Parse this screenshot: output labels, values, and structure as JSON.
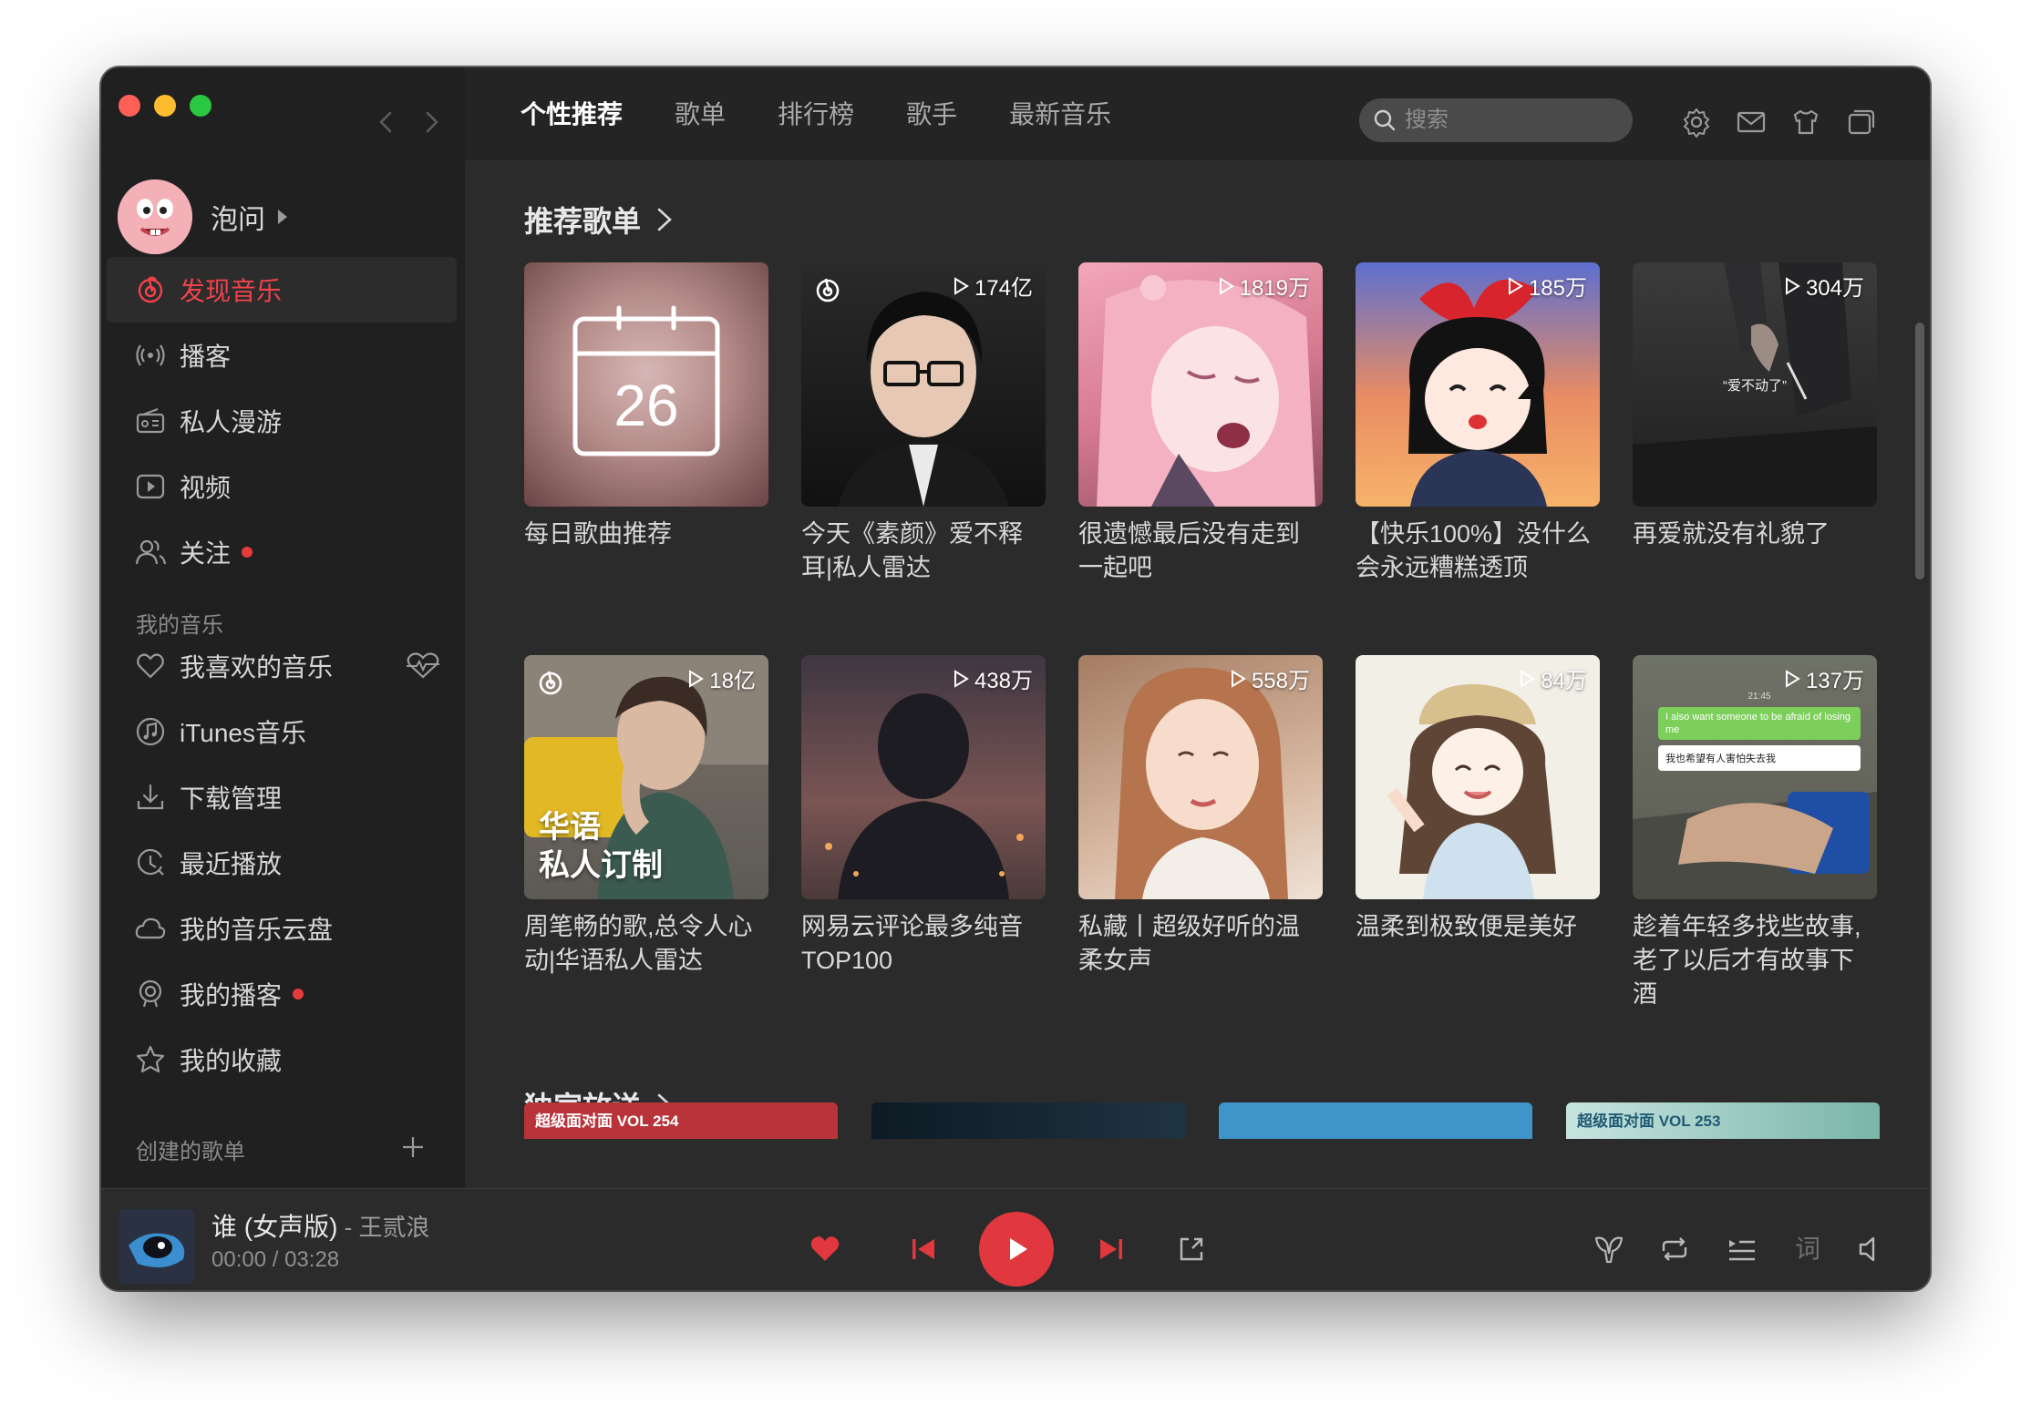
{
  "window": {
    "traffic_lights": [
      "close",
      "minimize",
      "zoom"
    ]
  },
  "header": {
    "tabs": [
      {
        "label": "个性推荐",
        "active": true
      },
      {
        "label": "歌单",
        "active": false
      },
      {
        "label": "排行榜",
        "active": false
      },
      {
        "label": "歌手",
        "active": false
      },
      {
        "label": "最新音乐",
        "active": false
      }
    ],
    "search_placeholder": "搜索",
    "icons": [
      "gear-icon",
      "mail-icon",
      "skin-icon",
      "mini-window-icon"
    ]
  },
  "sidebar": {
    "user": {
      "name": "泡问"
    },
    "nav": [
      {
        "label": "发现音乐",
        "icon": "netease-music-icon",
        "active": true,
        "dot": false
      },
      {
        "label": "播客",
        "icon": "podcast-icon",
        "active": false,
        "dot": false
      },
      {
        "label": "私人漫游",
        "icon": "radio-icon",
        "active": false,
        "dot": false
      },
      {
        "label": "视频",
        "icon": "video-icon",
        "active": false,
        "dot": false
      },
      {
        "label": "关注",
        "icon": "friends-icon",
        "active": false,
        "dot": true
      }
    ],
    "my_music_title": "我的音乐",
    "my_music": [
      {
        "label": "我喜欢的音乐",
        "icon": "heart-icon",
        "dot": false
      },
      {
        "label": "iTunes音乐",
        "icon": "itunes-icon",
        "dot": false
      },
      {
        "label": "下载管理",
        "icon": "download-icon",
        "dot": false
      },
      {
        "label": "最近播放",
        "icon": "recent-icon",
        "dot": false
      },
      {
        "label": "我的音乐云盘",
        "icon": "cloud-icon",
        "dot": false
      },
      {
        "label": "我的播客",
        "icon": "my-podcast-icon",
        "dot": true
      },
      {
        "label": "我的收藏",
        "icon": "star-icon",
        "dot": false
      }
    ],
    "created_playlists_title": "创建的歌单"
  },
  "main": {
    "recommended_title": "推荐歌单",
    "playlists": [
      {
        "name": "每日歌曲推荐",
        "plays": "",
        "radar": false,
        "daily_date": "26"
      },
      {
        "name": "今天《素颜》爱不释耳|私人雷达",
        "plays": "174亿",
        "radar": true
      },
      {
        "name": "很遗憾最后没有走到一起吧",
        "plays": "1819万",
        "radar": false
      },
      {
        "name": "【快乐100%】没什么会永远糟糕透顶",
        "plays": "185万",
        "radar": false
      },
      {
        "name": "再爱就没有礼貌了",
        "plays": "304万",
        "radar": false,
        "cover_caption": "“爱不动了”"
      },
      {
        "name": "周笔畅的歌,总令人心动|华语私人雷达",
        "plays": "18亿",
        "radar": true,
        "cover_caption": "华语\n私人订制"
      },
      {
        "name": "网易云评论最多纯音TOP100",
        "plays": "438万",
        "radar": false
      },
      {
        "name": "私藏丨超级好听的温柔女声",
        "plays": "558万",
        "radar": false
      },
      {
        "name": "温柔到极致便是美好",
        "plays": "84万",
        "radar": false
      },
      {
        "name": "趁着年轻多找些故事,老了以后才有故事下酒",
        "plays": "137万",
        "radar": false,
        "cover_chat": [
          "21:45",
          "I also want someone to be afraid of losing me",
          "我也希望有人害怕失去我"
        ]
      }
    ],
    "exclusive_title": "独家放送",
    "exclusive_cards": [
      "超级面对面 VOL 254",
      "",
      "",
      "超级面对面 VOL 253"
    ]
  },
  "player": {
    "song": "谁 (女声版)",
    "artist": "王贰浪",
    "separator": " - ",
    "current_time": "00:00",
    "total_time": "03:28",
    "time_separator": " / ",
    "lyrics_label": "词",
    "colors": {
      "accent": "#e0383e",
      "heart": "#e0383e"
    }
  },
  "colors": {
    "accent": "#f0434b",
    "background": "#2b2b2b",
    "sidebar": "#202020"
  }
}
